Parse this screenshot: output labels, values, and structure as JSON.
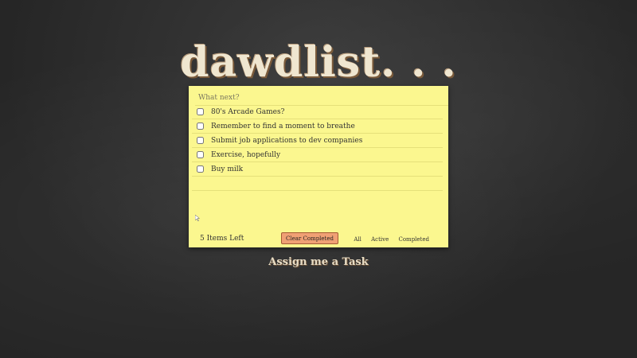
{
  "app": {
    "title": "dawdlist. . .",
    "subtitle": "Assign me a Task"
  },
  "new_task": {
    "placeholder": "What next?",
    "value": ""
  },
  "tasks": [
    {
      "text": "80's Arcade Games?",
      "completed": false
    },
    {
      "text": "Remember to find a moment to breathe",
      "completed": false
    },
    {
      "text": "Submit job applications to dev companies",
      "completed": false
    },
    {
      "text": "Exercise, hopefully",
      "completed": false
    },
    {
      "text": "Buy milk",
      "completed": false
    }
  ],
  "footer": {
    "count": "5",
    "count_label": "Items Left",
    "clear_label": "Clear Completed",
    "filters": [
      "All",
      "Active",
      "Completed"
    ]
  },
  "colors": {
    "note": "#fbf78f",
    "clear_button": "#f0a074",
    "title": "#efe6d0"
  }
}
